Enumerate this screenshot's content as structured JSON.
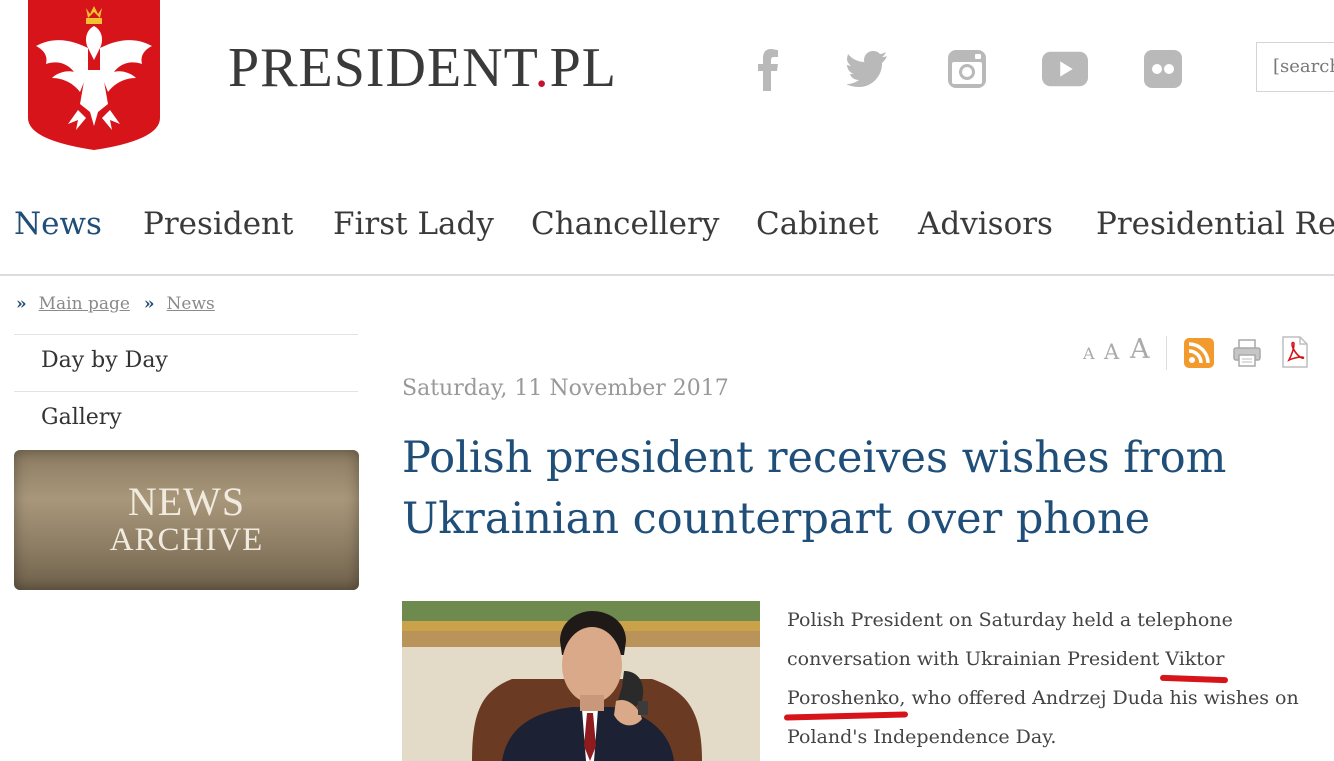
{
  "header": {
    "site_title_main": "PRESIDENT",
    "site_title_dot": ".",
    "site_title_tld": "PL",
    "social_icons": [
      "facebook-icon",
      "twitter-icon",
      "instagram-icon",
      "youtube-icon",
      "flickr-icon"
    ],
    "search_placeholder": "[search]"
  },
  "nav": {
    "items": [
      "News",
      "President",
      "First Lady",
      "Chancellery",
      "Cabinet",
      "Advisors",
      "Presidential Res"
    ]
  },
  "breadcrumb": {
    "sep": "»",
    "items": [
      "Main page",
      "News"
    ]
  },
  "sidebar": {
    "items": [
      "Day by Day",
      "Gallery"
    ],
    "archive_line1": "NEWS",
    "archive_line2": "ARCHIVE"
  },
  "tools": {
    "font_sizes": [
      "A",
      "A",
      "A"
    ],
    "icons": [
      "rss-icon",
      "print-icon",
      "pdf-icon"
    ]
  },
  "article": {
    "date": "Saturday, 11 November 2017",
    "title": "Polish president receives wishes from Ukrainian counterpart over phone",
    "body_lines": [
      "Polish President on Saturday held a telephone",
      "conversation with Ukrainian President Viktor",
      "Poroshenko, who offered Andrzej Duda his wishes on",
      "Poland's Independence Day."
    ]
  },
  "colors": {
    "link_blue": "#1f4e79",
    "emblem_red": "#d7141a",
    "underline_red": "#d7141a",
    "rss_orange": "#f29a2e"
  }
}
